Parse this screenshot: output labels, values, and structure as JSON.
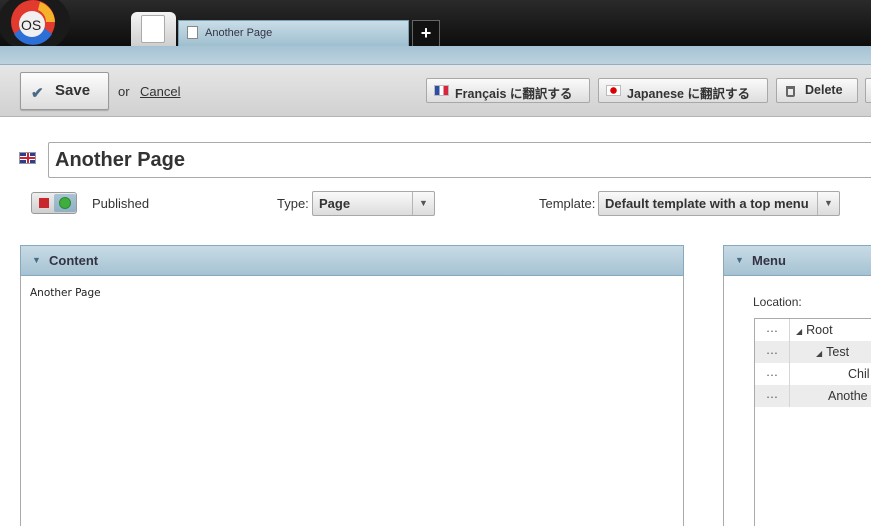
{
  "app": {
    "logo_text": "OS"
  },
  "tabs": [
    {
      "label": "Another Page"
    }
  ],
  "tab_add_label": "+",
  "toolbar": {
    "save_label": "Save",
    "or_label": "or",
    "cancel_label": "Cancel",
    "translate_fr_label": "Français に翻訳する",
    "translate_jp_label": "Japanese に翻訳する",
    "delete_label": "Delete"
  },
  "page": {
    "title_value": "Another Page",
    "status_label": "Published",
    "type_label": "Type:",
    "type_value": "Page",
    "template_label": "Template:",
    "template_value": "Default template with a top menu"
  },
  "content_panel": {
    "title": "Content",
    "body_text": "Another Page"
  },
  "menu_panel": {
    "title": "Menu",
    "location_label": "Location:",
    "tree": [
      {
        "dots": "…",
        "label": "Root"
      },
      {
        "dots": "…",
        "label": "Test"
      },
      {
        "dots": "…",
        "label": "Chil"
      },
      {
        "dots": "…",
        "label": "Anothe"
      }
    ]
  },
  "colors": {
    "panel_header": "#a6c2d2",
    "status_on": "#3fae3f",
    "status_off": "#c8282d"
  }
}
